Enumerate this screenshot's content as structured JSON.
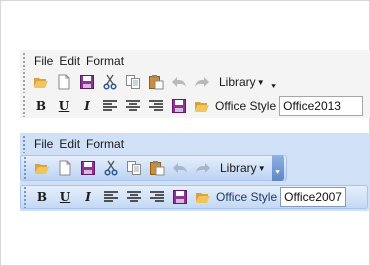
{
  "office2013": {
    "menu": [
      "File",
      "Edit",
      "Format"
    ],
    "toolbar1": {
      "buttons": [
        "open-icon",
        "new-icon",
        "save-icon",
        "cut-icon",
        "copy-icon",
        "paste-icon",
        "undo-icon",
        "redo-icon"
      ],
      "library_label": "Library"
    },
    "toolbar2": {
      "format_buttons": [
        "B",
        "U",
        "I"
      ],
      "align_buttons": [
        "align-left-icon",
        "align-center-icon",
        "align-right-icon"
      ],
      "style_label": "Office Style",
      "style_value": "Office2013"
    }
  },
  "office2007": {
    "menu": [
      "File",
      "Edit",
      "Format"
    ],
    "toolbar1": {
      "buttons": [
        "open-icon",
        "new-icon",
        "save-icon",
        "cut-icon",
        "copy-icon",
        "paste-icon",
        "undo-icon",
        "redo-icon"
      ],
      "library_label": "Library"
    },
    "toolbar2": {
      "format_buttons": [
        "B",
        "U",
        "I"
      ],
      "align_buttons": [
        "align-left-icon",
        "align-center-icon",
        "align-right-icon"
      ],
      "style_label": "Office Style",
      "style_value": "Office2007"
    }
  },
  "colors": {
    "panel_2013": "#f4f4f4",
    "panel_2007": "#cfe0f7",
    "save_purple": "#7b2a86",
    "folder_yellow": "#e8b64c",
    "cut_blue": "#2b5797"
  }
}
